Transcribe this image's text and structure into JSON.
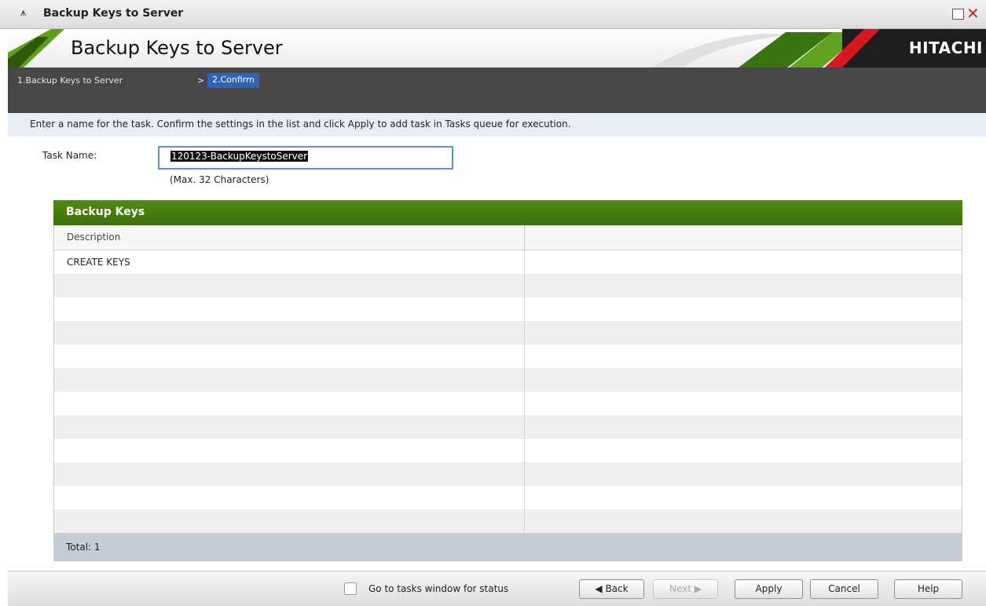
{
  "window": {
    "title": "Backup Keys to Server",
    "collapse_glyph": "⩚",
    "close_glyph": "✕"
  },
  "banner": {
    "title": "Backup Keys to Server",
    "logo": "HITACHI"
  },
  "steps": {
    "step1": "1.Backup Keys to Server",
    "separator": ">",
    "step2": "2.Confirm"
  },
  "instruction": "Enter a name for the task. Confirm the settings in the list and click Apply to add task in Tasks queue for execution.",
  "task": {
    "label": "Task Name:",
    "value": "120123-BackupKeystoServer",
    "hint": "(Max. 32 Characters)"
  },
  "table": {
    "title": "Backup Keys",
    "column": "Description",
    "rows": [
      "CREATE KEYS"
    ],
    "total": "Total:  1"
  },
  "footer": {
    "goto_label": "Go to tasks window for status",
    "back": "◀ Back",
    "next": "Next ▶",
    "apply": "Apply",
    "cancel": "Cancel",
    "help": "Help"
  },
  "colors": {
    "accent_green": "#4e8a12",
    "step_active": "#2f63b8",
    "close_red": "#d0261b"
  }
}
